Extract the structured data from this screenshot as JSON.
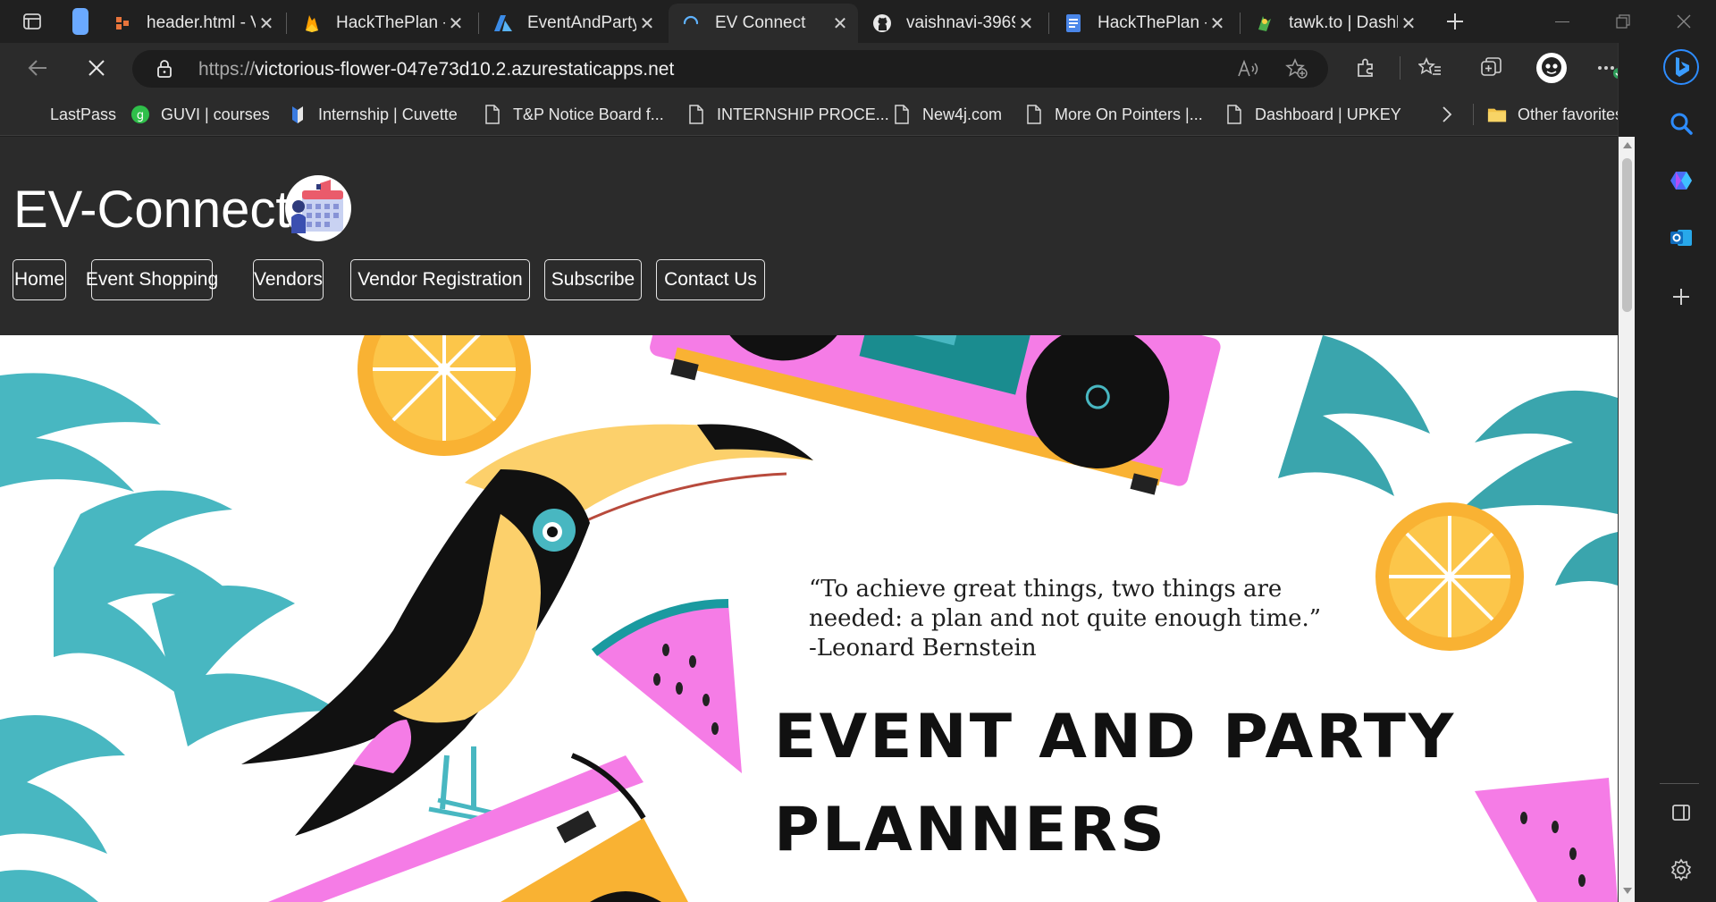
{
  "browser": {
    "tabs": [
      {
        "title": "header.html - V",
        "icon": "file-icon",
        "active": false
      },
      {
        "title": "HackThePlan - ",
        "icon": "firebase-icon",
        "active": false
      },
      {
        "title": "EventAndParty",
        "icon": "azure-icon",
        "active": false
      },
      {
        "title": "EV Connect",
        "icon": "loading-icon",
        "active": true
      },
      {
        "title": "vaishnavi-3969",
        "icon": "github-icon",
        "active": false
      },
      {
        "title": "HackThePlan - ",
        "icon": "docs-icon",
        "active": false
      },
      {
        "title": "tawk.to | Dashb",
        "icon": "tawk-icon",
        "active": false
      }
    ],
    "url_protocol": "https://",
    "url_host": "victorious-flower-047e73d10.2.azurestaticapps.net",
    "bookmarks": [
      {
        "label": "LastPass",
        "icon": "none"
      },
      {
        "label": "GUVI | courses",
        "icon": "guvi-icon"
      },
      {
        "label": "Internship | Cuvette",
        "icon": "cuvette-icon"
      },
      {
        "label": "T&P Notice Board f...",
        "icon": "page-icon"
      },
      {
        "label": "INTERNSHIP PROCE...",
        "icon": "page-icon"
      },
      {
        "label": "New4j.com",
        "icon": "page-icon"
      },
      {
        "label": "More On Pointers |...",
        "icon": "page-icon"
      },
      {
        "label": "Dashboard | UPKEY",
        "icon": "page-icon"
      }
    ],
    "other_favorites": "Other favorites"
  },
  "site": {
    "title": "EV-Connect",
    "nav": [
      "Home",
      "Event Shopping",
      "Vendors",
      "Vendor Registration",
      "Subscribe",
      "Contact Us"
    ],
    "quote_lines": [
      "“To achieve great things, two things are",
      "needed: a plan and not quite enough time.”",
      "-Leonard Bernstein"
    ],
    "headline_lines": [
      "EVENT AND PARTY",
      "PLANNERS"
    ]
  },
  "colors": {
    "header_bg": "#2b2b2b",
    "teal": "#48b7c1",
    "orange": "#f9b233",
    "pink": "#f57ce6",
    "toucan_yellow": "#fcd06b"
  }
}
